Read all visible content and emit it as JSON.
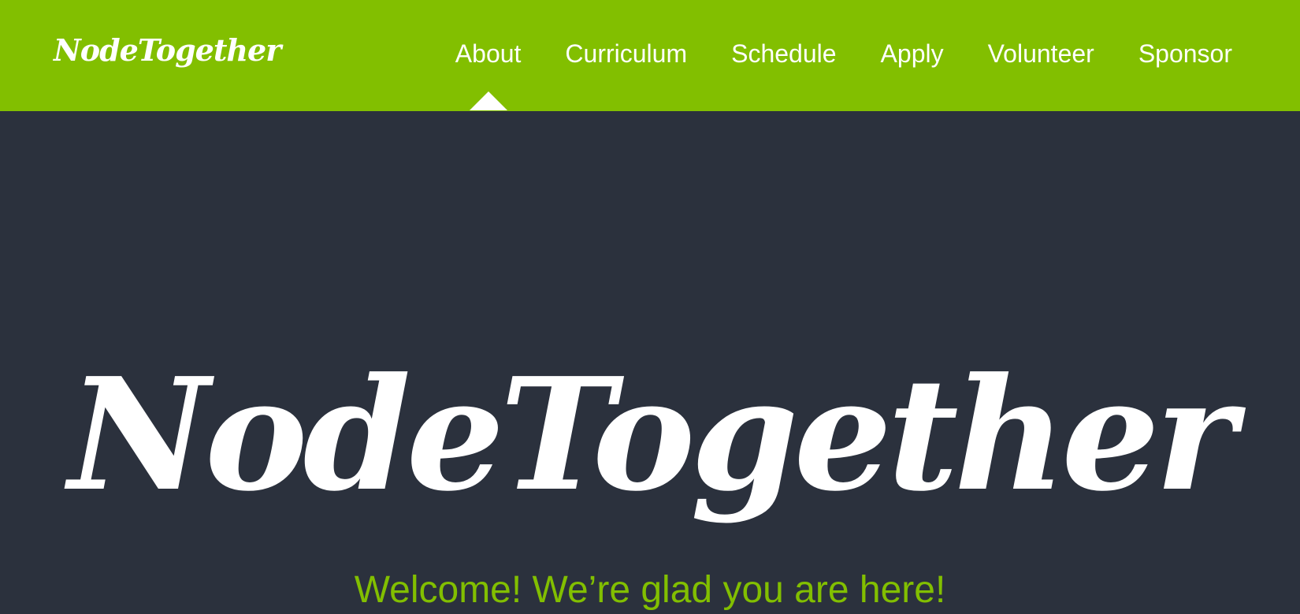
{
  "header": {
    "brand": "NodeTogether",
    "nav": [
      {
        "label": "About",
        "active": true
      },
      {
        "label": "Curriculum",
        "active": false
      },
      {
        "label": "Schedule",
        "active": false
      },
      {
        "label": "Apply",
        "active": false
      },
      {
        "label": "Volunteer",
        "active": false
      },
      {
        "label": "Sponsor",
        "active": false
      }
    ]
  },
  "hero": {
    "logo_text": "NodeTogether",
    "tagline": "Welcome! We’re glad you are here!"
  },
  "colors": {
    "accent": "#82bf00",
    "background": "#2b313d",
    "text": "#ffffff"
  }
}
